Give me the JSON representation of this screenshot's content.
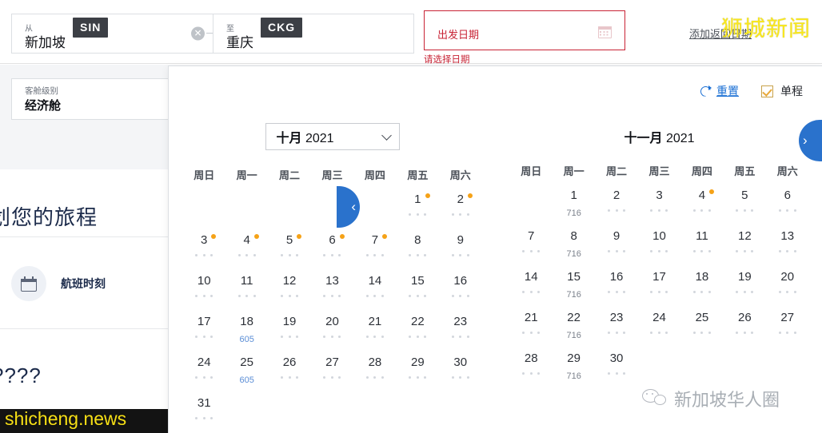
{
  "search": {
    "from": {
      "caption": "从",
      "city": "新加坡",
      "code": "SIN",
      "clear": "✕"
    },
    "to": {
      "caption": "至",
      "city": "重庆",
      "code": "CKG",
      "clear": "✕"
    },
    "date": {
      "placeholder": "出发日期",
      "error": "请选择日期",
      "icon": "calendar-icon",
      "border_color": "#c82335"
    },
    "return_link": "添加返回日期",
    "cabin": {
      "caption": "客舱级别",
      "value": "经济舱"
    }
  },
  "background": {
    "plan_title": "计划您的旅程",
    "flight_schedule": "航班时刻",
    "question_text": "????",
    "watermark_bottom": "shicheng.news"
  },
  "watermarks": {
    "top_right": "狮城新闻",
    "bottom_right": "新加坡华人圈",
    "top_right_color": "#f9e81c"
  },
  "calendar": {
    "reset_label": "重置",
    "reset_icon": "refresh-icon",
    "oneway_label": "单程",
    "oneway_checked": true,
    "prev_label": "‹",
    "next_label": "›",
    "chevron_icon": "chevron-down-icon",
    "accent_blue": "#2a72cc",
    "dot_color": "#f5a217",
    "weekdays": [
      "周日",
      "周一",
      "周二",
      "周三",
      "周四",
      "周五",
      "周六"
    ],
    "months": [
      {
        "name": "十月",
        "year": "2021",
        "is_select": true,
        "lead_blanks": 5,
        "days": [
          {
            "n": "1",
            "dot": true,
            "price": null,
            "dots": true
          },
          {
            "n": "2",
            "dot": true,
            "price": null,
            "dots": true
          },
          {
            "n": "3",
            "dot": true,
            "price": null,
            "dots": true
          },
          {
            "n": "4",
            "dot": true,
            "price": null,
            "dots": true
          },
          {
            "n": "5",
            "dot": true,
            "price": null,
            "dots": true
          },
          {
            "n": "6",
            "dot": true,
            "price": null,
            "dots": true
          },
          {
            "n": "7",
            "dot": true,
            "price": null,
            "dots": true
          },
          {
            "n": "8",
            "dot": false,
            "price": null,
            "dots": true
          },
          {
            "n": "9",
            "dot": false,
            "price": null,
            "dots": true
          },
          {
            "n": "10",
            "dot": false,
            "price": null,
            "dots": true
          },
          {
            "n": "11",
            "dot": false,
            "price": null,
            "dots": true
          },
          {
            "n": "12",
            "dot": false,
            "price": null,
            "dots": true
          },
          {
            "n": "13",
            "dot": false,
            "price": null,
            "dots": true
          },
          {
            "n": "14",
            "dot": false,
            "price": null,
            "dots": true
          },
          {
            "n": "15",
            "dot": false,
            "price": null,
            "dots": true
          },
          {
            "n": "16",
            "dot": false,
            "price": null,
            "dots": true
          },
          {
            "n": "17",
            "dot": false,
            "price": null,
            "dots": true
          },
          {
            "n": "18",
            "dot": false,
            "price": "605",
            "price_style": "blue",
            "dots": false
          },
          {
            "n": "19",
            "dot": false,
            "price": null,
            "dots": true
          },
          {
            "n": "20",
            "dot": false,
            "price": null,
            "dots": true
          },
          {
            "n": "21",
            "dot": false,
            "price": null,
            "dots": true
          },
          {
            "n": "22",
            "dot": false,
            "price": null,
            "dots": true
          },
          {
            "n": "23",
            "dot": false,
            "price": null,
            "dots": true
          },
          {
            "n": "24",
            "dot": false,
            "price": null,
            "dots": true
          },
          {
            "n": "25",
            "dot": false,
            "price": "605",
            "price_style": "blue",
            "dots": false
          },
          {
            "n": "26",
            "dot": false,
            "price": null,
            "dots": true
          },
          {
            "n": "27",
            "dot": false,
            "price": null,
            "dots": true
          },
          {
            "n": "28",
            "dot": false,
            "price": null,
            "dots": true
          },
          {
            "n": "29",
            "dot": false,
            "price": null,
            "dots": true
          },
          {
            "n": "30",
            "dot": false,
            "price": null,
            "dots": true
          },
          {
            "n": "31",
            "dot": false,
            "price": null,
            "dots": true
          }
        ]
      },
      {
        "name": "十一月",
        "year": "2021",
        "is_select": false,
        "lead_blanks": 1,
        "days": [
          {
            "n": "1",
            "dot": false,
            "price": "716",
            "price_style": "grey",
            "dots": false
          },
          {
            "n": "2",
            "dot": false,
            "price": null,
            "dots": true
          },
          {
            "n": "3",
            "dot": false,
            "price": null,
            "dots": true
          },
          {
            "n": "4",
            "dot": true,
            "price": null,
            "dots": true
          },
          {
            "n": "5",
            "dot": false,
            "price": null,
            "dots": true
          },
          {
            "n": "6",
            "dot": false,
            "price": null,
            "dots": true
          },
          {
            "n": "7",
            "dot": false,
            "price": null,
            "dots": true
          },
          {
            "n": "8",
            "dot": false,
            "price": "716",
            "price_style": "grey",
            "dots": false
          },
          {
            "n": "9",
            "dot": false,
            "price": null,
            "dots": true
          },
          {
            "n": "10",
            "dot": false,
            "price": null,
            "dots": true
          },
          {
            "n": "11",
            "dot": false,
            "price": null,
            "dots": true
          },
          {
            "n": "12",
            "dot": false,
            "price": null,
            "dots": true
          },
          {
            "n": "13",
            "dot": false,
            "price": null,
            "dots": true
          },
          {
            "n": "14",
            "dot": false,
            "price": null,
            "dots": true
          },
          {
            "n": "15",
            "dot": false,
            "price": "716",
            "price_style": "grey",
            "dots": false
          },
          {
            "n": "16",
            "dot": false,
            "price": null,
            "dots": true
          },
          {
            "n": "17",
            "dot": false,
            "price": null,
            "dots": true
          },
          {
            "n": "18",
            "dot": false,
            "price": null,
            "dots": true
          },
          {
            "n": "19",
            "dot": false,
            "price": null,
            "dots": true
          },
          {
            "n": "20",
            "dot": false,
            "price": null,
            "dots": true
          },
          {
            "n": "21",
            "dot": false,
            "price": null,
            "dots": true
          },
          {
            "n": "22",
            "dot": false,
            "price": "716",
            "price_style": "grey",
            "dots": false
          },
          {
            "n": "23",
            "dot": false,
            "price": null,
            "dots": true
          },
          {
            "n": "24",
            "dot": false,
            "price": null,
            "dots": true
          },
          {
            "n": "25",
            "dot": false,
            "price": null,
            "dots": true
          },
          {
            "n": "26",
            "dot": false,
            "price": null,
            "dots": true
          },
          {
            "n": "27",
            "dot": false,
            "price": null,
            "dots": true
          },
          {
            "n": "28",
            "dot": false,
            "price": null,
            "dots": true
          },
          {
            "n": "29",
            "dot": false,
            "price": "716",
            "price_style": "grey",
            "dots": false
          },
          {
            "n": "30",
            "dot": false,
            "price": null,
            "dots": true
          }
        ]
      }
    ]
  }
}
